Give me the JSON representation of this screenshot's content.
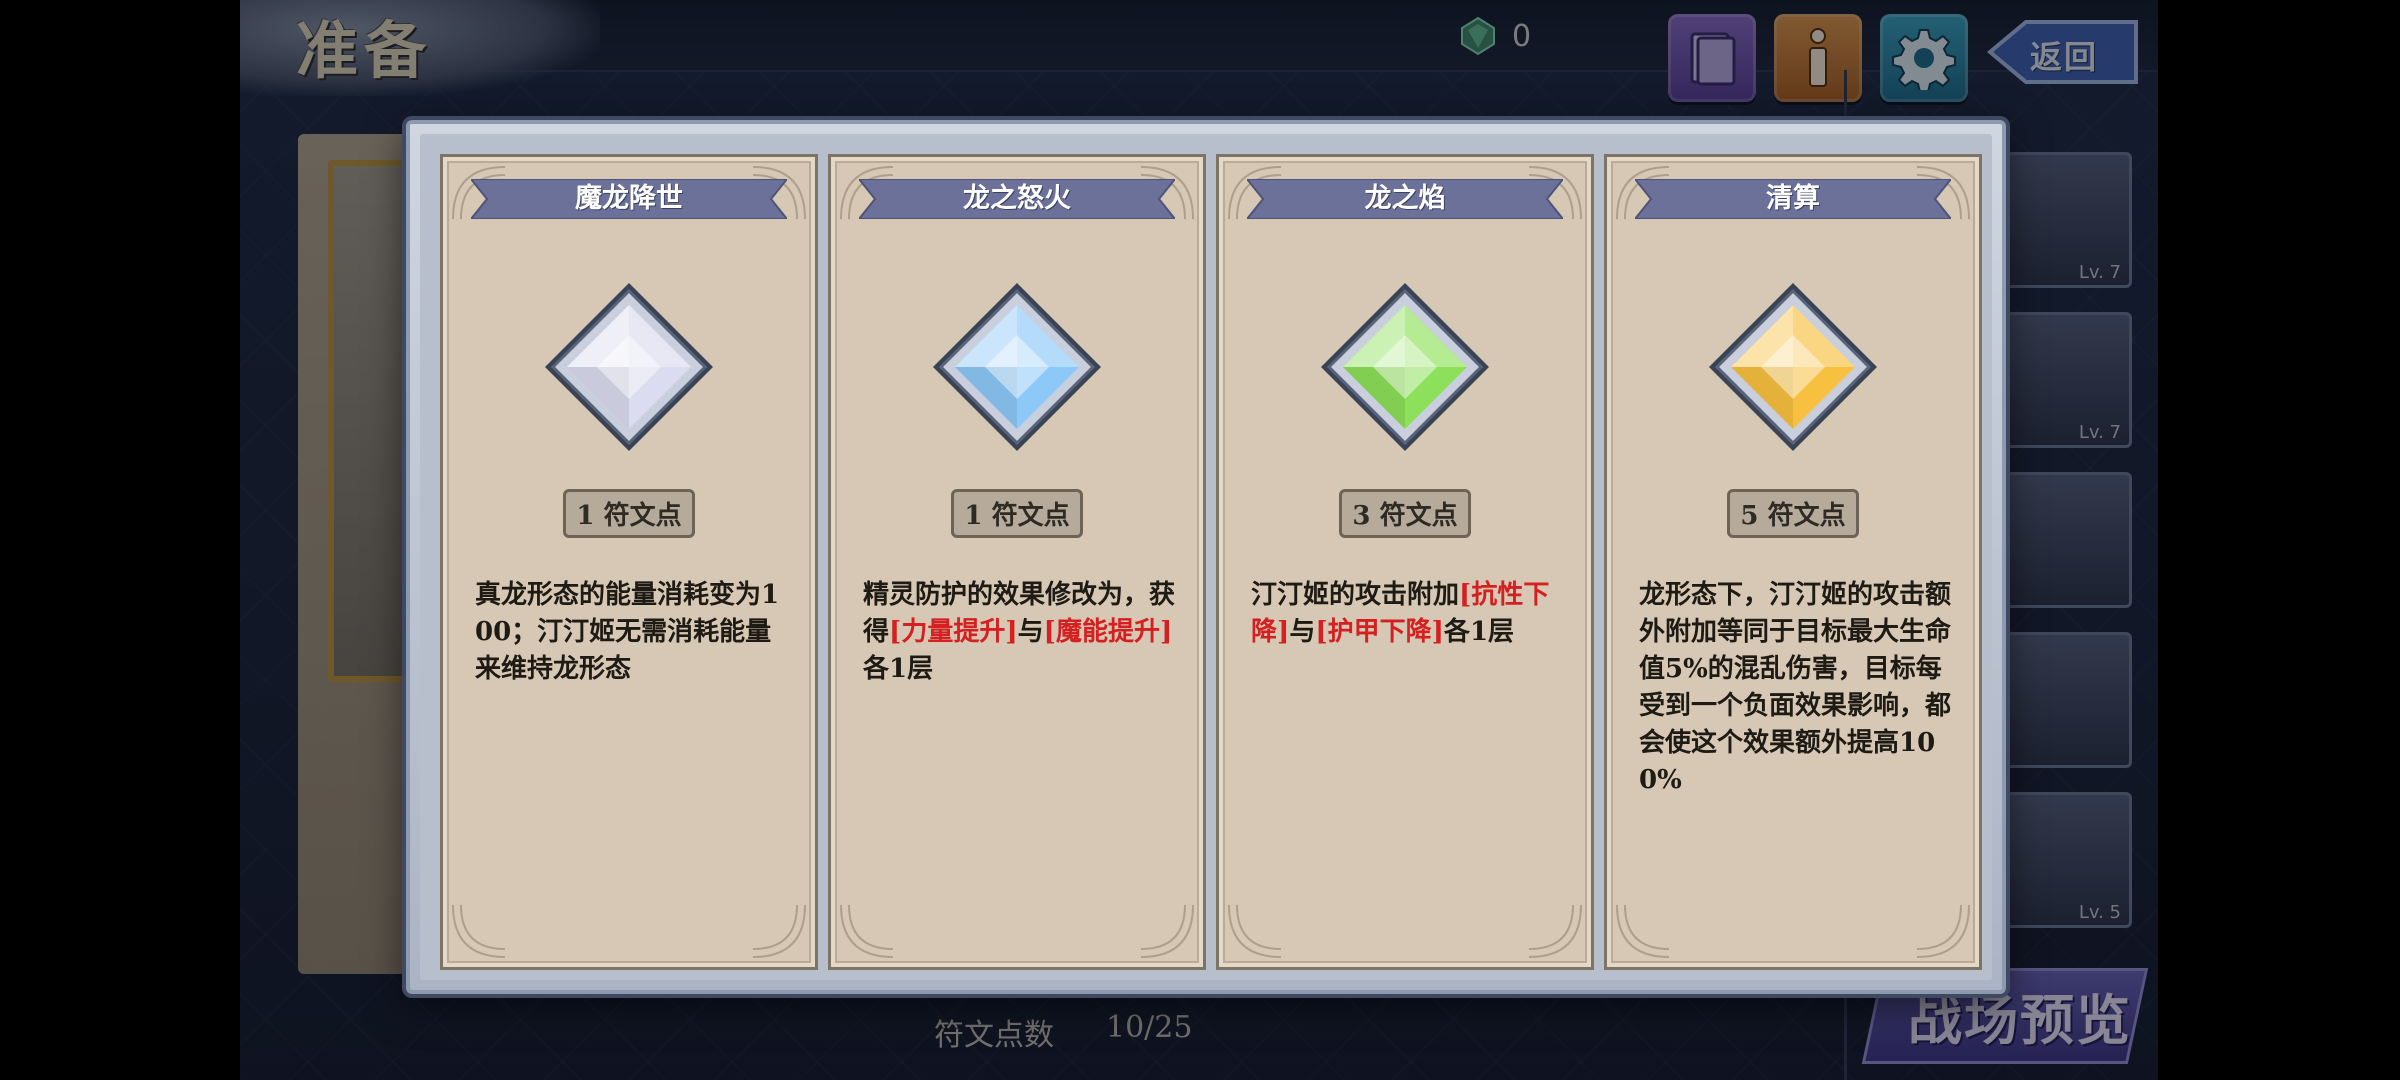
{
  "header": {
    "title": "准备",
    "gem_count": "0",
    "back_label": "返回"
  },
  "background": {
    "rune_points_label": "符文点数",
    "rune_points_value": "10/25",
    "battle_preview_label": "战场预览",
    "card_levels": [
      "Lv. 7",
      "Lv. 7",
      "",
      "",
      "Lv. 5"
    ]
  },
  "modal": {
    "runes": [
      {
        "name": "魔龙降世",
        "cost": "1 符文点",
        "gem_color": "#dcdcf0",
        "gem_icon": "white-diamond-gem-icon",
        "desc": [
          {
            "text": "真龙形态的能量消耗变为100；汀汀姬无需消耗能量来维持龙形态",
            "red": false
          }
        ]
      },
      {
        "name": "龙之怒火",
        "cost": "1 符文点",
        "gem_color": "#8cc8f8",
        "gem_icon": "blue-diamond-gem-icon",
        "desc": [
          {
            "text": "精灵防护的效果修改为，获得",
            "red": false
          },
          {
            "text": "[力量提升]",
            "red": true
          },
          {
            "text": "与",
            "red": false
          },
          {
            "text": "[魔能提升]",
            "red": true
          },
          {
            "text": "各1层",
            "red": false
          }
        ]
      },
      {
        "name": "龙之焰",
        "cost": "3 符文点",
        "gem_color": "#8ce05a",
        "gem_icon": "green-diamond-gem-icon",
        "desc": [
          {
            "text": "汀汀姬的攻击附加",
            "red": false
          },
          {
            "text": "[抗性下降]",
            "red": true
          },
          {
            "text": "与",
            "red": false
          },
          {
            "text": "[护甲下降]",
            "red": true
          },
          {
            "text": "各1层",
            "red": false
          }
        ]
      },
      {
        "name": "清算",
        "cost": "5 符文点",
        "gem_color": "#f8c040",
        "gem_icon": "orange-diamond-gem-icon",
        "desc": [
          {
            "text": "龙形态下，汀汀姬的攻击额外附加等同于目标最大生命值5%的混乱伤害，目标每受到一个负面效果影响，都会使这个效果额外提高100%",
            "red": false
          }
        ]
      }
    ]
  },
  "colors": {
    "accent_red": "#d42020",
    "banner": "#6b7199",
    "card_bg": "#d7c8b5"
  }
}
